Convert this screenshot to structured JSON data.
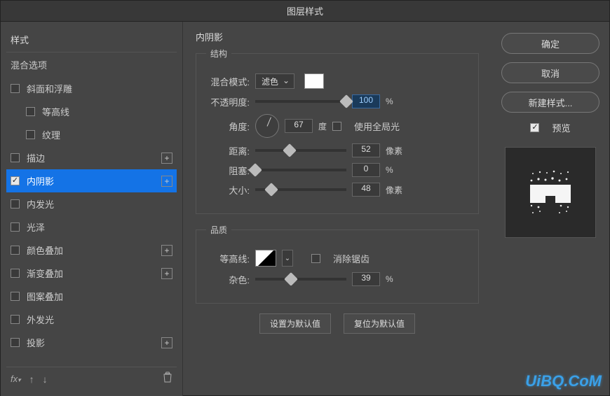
{
  "dialog": {
    "title": "图层样式"
  },
  "sidebar": {
    "header": "样式",
    "blendOptions": "混合选项",
    "items": [
      {
        "label": "斜面和浮雕",
        "checked": false,
        "indent": false,
        "add": false
      },
      {
        "label": "等高线",
        "checked": false,
        "indent": true,
        "add": false
      },
      {
        "label": "纹理",
        "checked": false,
        "indent": true,
        "add": false
      },
      {
        "label": "描边",
        "checked": false,
        "indent": false,
        "add": true
      },
      {
        "label": "内阴影",
        "checked": true,
        "indent": false,
        "add": true,
        "selected": true
      },
      {
        "label": "内发光",
        "checked": false,
        "indent": false,
        "add": false
      },
      {
        "label": "光泽",
        "checked": false,
        "indent": false,
        "add": false
      },
      {
        "label": "颜色叠加",
        "checked": false,
        "indent": false,
        "add": true
      },
      {
        "label": "渐变叠加",
        "checked": false,
        "indent": false,
        "add": true
      },
      {
        "label": "图案叠加",
        "checked": false,
        "indent": false,
        "add": false
      },
      {
        "label": "外发光",
        "checked": false,
        "indent": false,
        "add": false
      },
      {
        "label": "投影",
        "checked": false,
        "indent": false,
        "add": true
      }
    ]
  },
  "main": {
    "title": "内阴影",
    "structure": {
      "legend": "结构",
      "blendModeLabel": "混合模式:",
      "blendModeValue": "滤色",
      "opacityLabel": "不透明度:",
      "opacityValue": "100",
      "opacityUnit": "%",
      "angleLabel": "角度:",
      "angleValue": "67",
      "angleUnit": "度",
      "globalLightLabel": "使用全局光",
      "distanceLabel": "距离:",
      "distanceValue": "52",
      "distanceUnit": "像素",
      "chokeLabel": "阻塞:",
      "chokeValue": "0",
      "chokeUnit": "%",
      "sizeLabel": "大小:",
      "sizeValue": "48",
      "sizeUnit": "像素"
    },
    "quality": {
      "legend": "品质",
      "contourLabel": "等高线:",
      "antiAliasLabel": "消除锯齿",
      "noiseLabel": "杂色:",
      "noiseValue": "39",
      "noiseUnit": "%"
    },
    "buttons": {
      "setDefault": "设置为默认值",
      "resetDefault": "复位为默认值"
    }
  },
  "right": {
    "ok": "确定",
    "cancel": "取消",
    "newStyle": "新建样式...",
    "preview": "预览"
  },
  "watermark": "UiBQ.CoM"
}
